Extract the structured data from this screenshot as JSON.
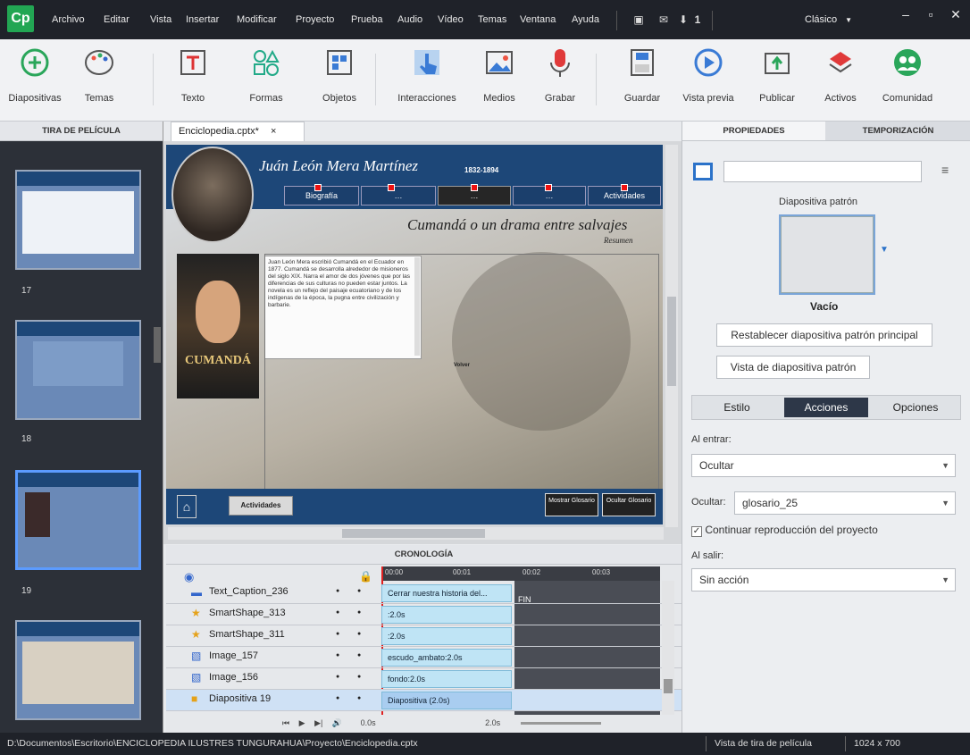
{
  "menubar": {
    "logo": "Cp",
    "items": [
      "Archivo",
      "Editar",
      "Vista",
      "Insertar",
      "Modificar",
      "Proyecto",
      "Prueba",
      "Audio",
      "Vídeo",
      "Temas",
      "Ventana",
      "Ayuda"
    ],
    "badge_count": "1",
    "theme_label": "Clásico",
    "window_buttons": [
      "–",
      "▫",
      "✕"
    ]
  },
  "toolbar": {
    "tools": [
      "Diapositivas",
      "Temas",
      "Texto",
      "Formas",
      "Objetos",
      "Interacciones",
      "Medios",
      "Grabar",
      "Guardar",
      "Vista previa",
      "Publicar",
      "Activos",
      "Comunidad"
    ]
  },
  "filmstrip": {
    "header": "TIRA DE PELÍCULA",
    "slide_numbers": [
      "17",
      "18",
      "19"
    ]
  },
  "document_tab": {
    "title": "Enciclopedia.cptx*",
    "close": "×"
  },
  "slide": {
    "name": "Juán León Mera Martínez",
    "years": "1832-1894",
    "nav_buttons": [
      "Biografía",
      "…",
      "…",
      "…",
      "Actividades"
    ],
    "subtitle": "Cumandá o un drama entre salvajes",
    "resumen": "Resumen",
    "book_title": "CUMANDÁ",
    "text_body": "Juan León Mera escribió Cumandá en el Ecuador en 1877. Cumandá se desarrolla alrededor de misioneros del siglo XIX. Narra el amor de dos jóvenes que por las diferencias de sus culturas no pueden estar juntos. La novela es un reflejo del paisaje ecuatoriano y de los indígenas de la época, la pugna entre civilización y barbarie.",
    "footer_actividades": "Actividades",
    "footer_mostrar": "Mostrar Glosario",
    "footer_ocultar": "Ocultar Glosario",
    "stage_label": "Volver"
  },
  "timeline": {
    "header": "CRONOLOGÍA",
    "ruler": [
      "00:00",
      "00:01",
      "00:02",
      "00:03"
    ],
    "rows": [
      {
        "name": "Text_Caption_236",
        "bar": "Cerrar nuestra historia del..."
      },
      {
        "name": "SmartShape_313",
        "bar": ":2.0s"
      },
      {
        "name": "SmartShape_311",
        "bar": ":2.0s"
      },
      {
        "name": "Image_157",
        "bar": "escudo_ambato:2.0s"
      },
      {
        "name": "Image_156",
        "bar": "fondo:2.0s"
      },
      {
        "name": "Diapositiva 19",
        "bar": "Diapositiva (2.0s)"
      }
    ],
    "end_label": "FIN",
    "controls_time": "0.0s",
    "controls_dur": "2.0s"
  },
  "right_panel": {
    "tab_properties": "PROPIEDADES",
    "tab_timing": "TEMPORIZACIÓN",
    "master_label": "Diapositiva patrón",
    "master_state": "Vacío",
    "btn_reset": "Restablecer diapositiva patrón principal",
    "btn_view": "Vista de diapositiva patrón",
    "subtabs": [
      "Estilo",
      "Acciones",
      "Opciones"
    ],
    "on_enter_label": "Al entrar:",
    "on_enter_value": "Ocultar",
    "hide_label": "Ocultar:",
    "hide_value": "glosario_25",
    "continue_label": "Continuar reproducción del proyecto",
    "on_exit_label": "Al salir:",
    "on_exit_value": "Sin acción"
  },
  "statusbar": {
    "path": "D:\\Documentos\\Escritorio\\ENCICLOPEDIA ILUSTRES TUNGURAHUA\\Proyecto\\Enciclopedia.cptx",
    "view": "Vista de tira de película",
    "size": "1024 x 700"
  },
  "colors": {
    "accent": "#1d4778",
    "selected_tab": "#2d3748",
    "logo_green": "#22a653"
  }
}
